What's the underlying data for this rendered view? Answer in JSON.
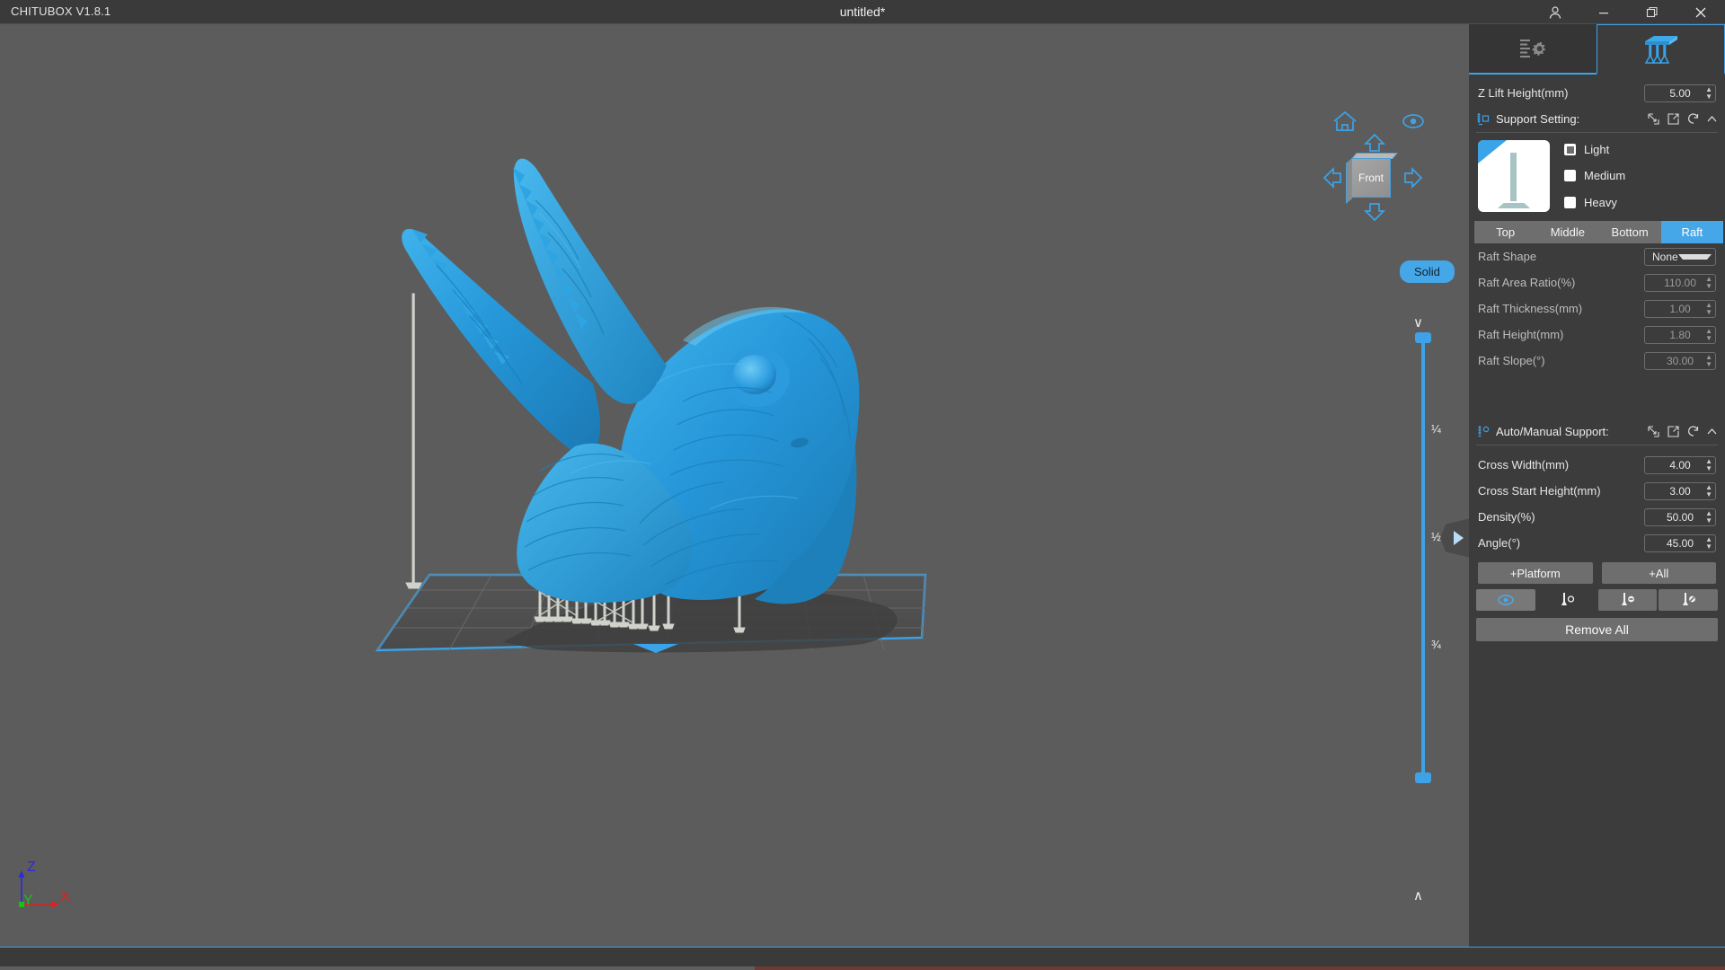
{
  "titlebar": {
    "app_name": "CHITUBOX V1.8.1",
    "doc_title": "untitled*",
    "account_icon": "user-icon",
    "minimize_icon": "minimize-icon",
    "restore_icon": "restore-icon",
    "close_icon": "close-icon"
  },
  "viewport": {
    "nav": {
      "home_icon": "home-icon",
      "eye_icon": "eye-icon",
      "up_icon": "arrow-up-icon",
      "down_icon": "arrow-down-icon",
      "left_icon": "arrow-left-icon",
      "right_icon": "arrow-right-icon",
      "cube_face_label": "Front"
    },
    "render_mode_button": "Solid",
    "slider": {
      "up_chevron": "chevron-up-icon",
      "down_chevron": "chevron-down-icon",
      "ticks": [
        "¼",
        "½",
        "¾"
      ]
    },
    "collapse_tab_icon": "triangle-right-icon",
    "axis_gizmo": {
      "z": "Z",
      "y": "Y",
      "x": "X",
      "z_color": "#2b2bdd",
      "y_color": "#14c414",
      "x_color": "#e02020"
    },
    "model_color": "#2596d8",
    "support_color": "#cfd3cc",
    "plate_edge_color": "#3ba3e8"
  },
  "panel": {
    "tabs": [
      {
        "name": "settings-tab",
        "icon": "settings-sliders-icon",
        "active": false
      },
      {
        "name": "support-tab",
        "icon": "support-pillars-icon",
        "active": true
      }
    ],
    "z_lift": {
      "label": "Z Lift Height(mm)",
      "value": "5.00"
    },
    "support_setting": {
      "title": "Support Setting:",
      "lead_icon": "support-ruler-icon",
      "actions": [
        "import-icon",
        "export-icon",
        "reset-icon",
        "collapse-chevron-icon"
      ],
      "thumbnail_icon": "support-preview-thumbnail",
      "options": [
        {
          "label": "Light",
          "checked": true
        },
        {
          "label": "Medium",
          "checked": false
        },
        {
          "label": "Heavy",
          "checked": false
        }
      ]
    },
    "segments": [
      {
        "label": "Top",
        "active": false
      },
      {
        "label": "Middle",
        "active": false
      },
      {
        "label": "Bottom",
        "active": false
      },
      {
        "label": "Raft",
        "active": true
      }
    ],
    "raft_fields": [
      {
        "label": "Raft Shape",
        "value": "None",
        "control": "select",
        "dim": false
      },
      {
        "label": "Raft Area Ratio(%)",
        "value": "110.00",
        "control": "spin",
        "dim": true
      },
      {
        "label": "Raft Thickness(mm)",
        "value": "1.00",
        "control": "spin",
        "dim": true
      },
      {
        "label": "Raft Height(mm)",
        "value": "1.80",
        "control": "spin",
        "dim": true
      },
      {
        "label": "Raft Slope(°)",
        "value": "30.00",
        "control": "spin",
        "dim": true
      }
    ],
    "auto_manual": {
      "title": "Auto/Manual Support:",
      "lead_icon": "support-point-icon",
      "actions": [
        "import-icon",
        "export-icon",
        "reset-icon",
        "collapse-chevron-icon"
      ],
      "fields": [
        {
          "label": "Cross Width(mm)",
          "value": "4.00"
        },
        {
          "label": "Cross Start Height(mm)",
          "value": "3.00"
        },
        {
          "label": "Density(%)",
          "value": "50.00"
        },
        {
          "label": "Angle(°)",
          "value": "45.00"
        }
      ]
    },
    "add_buttons": [
      {
        "label": "+Platform"
      },
      {
        "label": "+All"
      }
    ],
    "tool_icons": [
      {
        "name": "show-supports-icon",
        "state": "selected"
      },
      {
        "name": "add-support-icon",
        "state": "dark"
      },
      {
        "name": "delete-support-icon",
        "state": "normal"
      },
      {
        "name": "disable-support-icon",
        "state": "normal"
      }
    ],
    "remove_all_button": "Remove All",
    "accent_color": "#3ba3e8",
    "panel_bg": "#3c3c3c"
  },
  "statusbar": {
    "progress_left_pct": 44
  }
}
